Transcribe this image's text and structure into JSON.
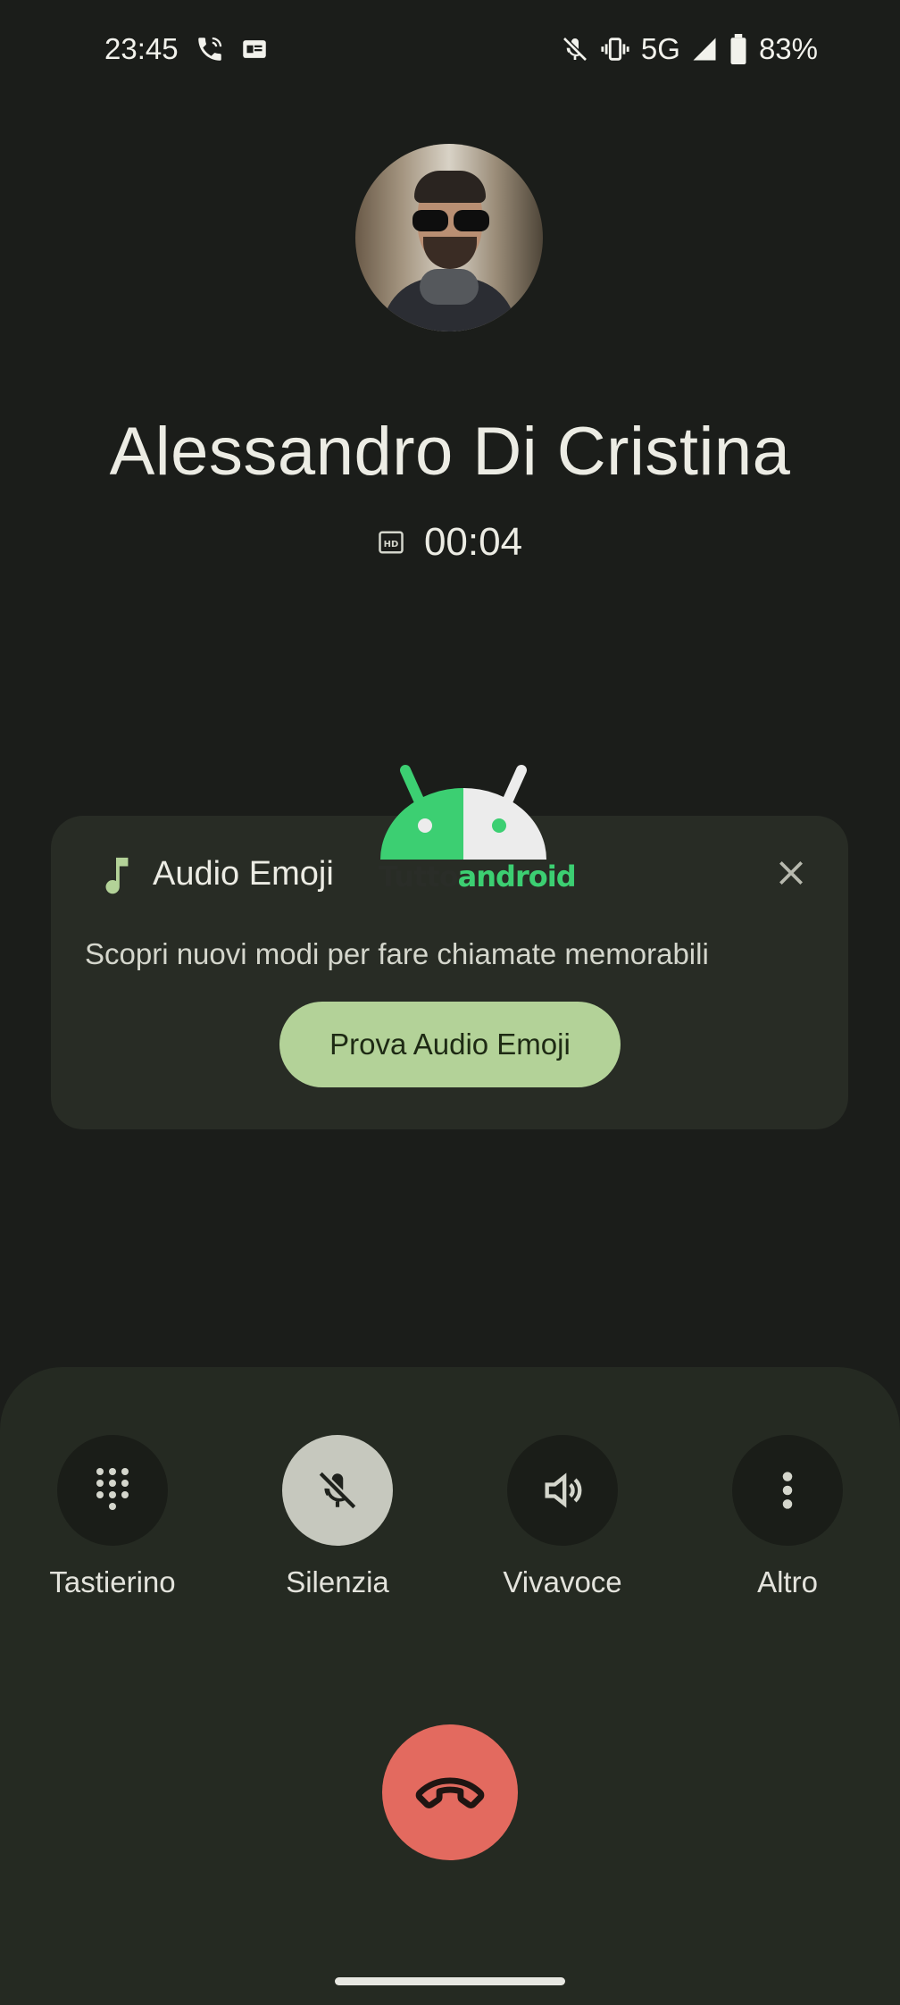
{
  "status_bar": {
    "time": "23:45",
    "left_icons": [
      "call-icon",
      "sim-card-icon"
    ],
    "right_icons": [
      "mic-off-icon",
      "vibrate-icon"
    ],
    "network": "5G",
    "battery": "83%"
  },
  "call": {
    "caller_name": "Alessandro Di Cristina",
    "hd_icon": "hd-icon",
    "timer": "00:04"
  },
  "audio_emoji_card": {
    "title": "Audio Emoji",
    "description": "Scopri nuovi modi per fare chiamate memorabili",
    "button_label": "Prova Audio Emoji",
    "accent_color": "#b3d298"
  },
  "watermark": {
    "text_part1": "Tutto",
    "text_part2": "android"
  },
  "controls": [
    {
      "label": "Tastierino",
      "icon": "dialpad-icon",
      "active": false
    },
    {
      "label": "Silenzia",
      "icon": "mic-off-icon",
      "active": true
    },
    {
      "label": "Vivavoce",
      "icon": "speaker-icon",
      "active": false
    },
    {
      "label": "Altro",
      "icon": "more-vert-icon",
      "active": false
    }
  ],
  "end_call": {
    "icon": "call-end-icon",
    "color": "#e36a5f"
  }
}
